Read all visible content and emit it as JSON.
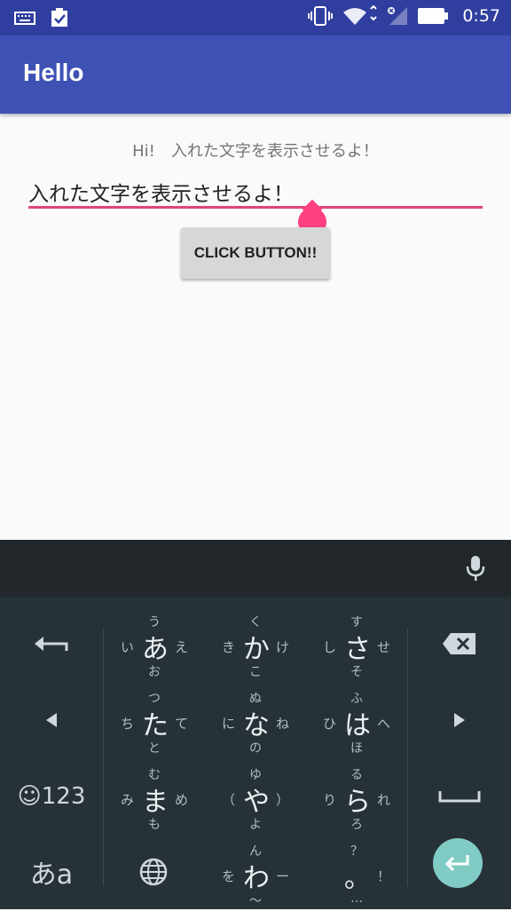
{
  "status_bar": {
    "time": "0:57",
    "icons": [
      "keyboard-icon",
      "clipboard-check-icon",
      "vibrate-icon",
      "wifi-icon",
      "signal-icon",
      "battery-icon"
    ]
  },
  "app_bar": {
    "title": "Hello"
  },
  "content": {
    "greeting": "Hi!　入れた文字を表示させるよ！",
    "input_value": "入れた文字を表示させるよ！",
    "button_label": "CLICK BUTTON!!"
  },
  "keyboard": {
    "flick_keys": [
      {
        "main": "あ",
        "up": "う",
        "left": "い",
        "right": "え",
        "down": "お"
      },
      {
        "main": "か",
        "up": "く",
        "left": "き",
        "right": "け",
        "down": "こ"
      },
      {
        "main": "さ",
        "up": "す",
        "left": "し",
        "right": "せ",
        "down": "そ"
      },
      {
        "main": "た",
        "up": "つ",
        "left": "ち",
        "right": "て",
        "down": "と"
      },
      {
        "main": "な",
        "up": "ぬ",
        "left": "に",
        "right": "ね",
        "down": "の"
      },
      {
        "main": "は",
        "up": "ふ",
        "left": "ひ",
        "right": "へ",
        "down": "ほ"
      },
      {
        "main": "ま",
        "up": "む",
        "left": "み",
        "right": "め",
        "down": "も"
      },
      {
        "main": "や",
        "up": "ゆ",
        "left": "（",
        "right": "）",
        "down": "よ"
      },
      {
        "main": "ら",
        "up": "る",
        "left": "り",
        "right": "れ",
        "down": "ろ"
      },
      {
        "main": "わ",
        "up": "ん",
        "left": "を",
        "right": "ー",
        "down": "〜"
      },
      {
        "main": "。",
        "up": "？",
        "left": "",
        "right": "！",
        "down": "…"
      }
    ],
    "emoji_num_label": "☺123",
    "mode_label": "あa"
  }
}
